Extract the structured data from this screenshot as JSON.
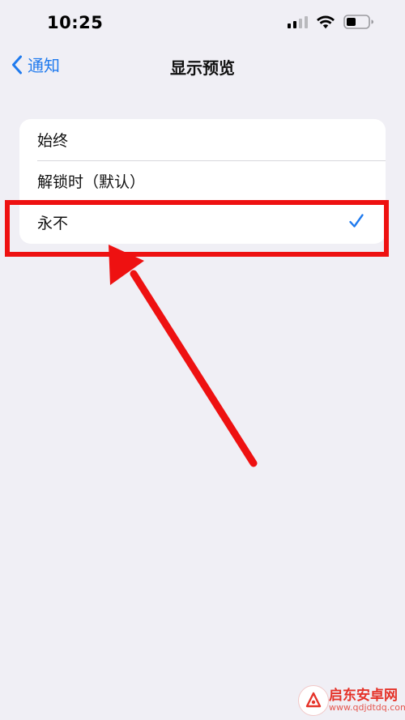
{
  "status_bar": {
    "time": "10:25",
    "icons": [
      "cellular-signal-icon",
      "wifi-icon",
      "battery-icon"
    ]
  },
  "nav": {
    "back_label": "通知",
    "title": "显示预览"
  },
  "options": [
    {
      "label": "始终",
      "selected": false
    },
    {
      "label": "解锁时（默认）",
      "selected": false
    },
    {
      "label": "永不",
      "selected": true
    }
  ],
  "colors": {
    "background": "#f0eff5",
    "accent": "#1f7aee",
    "annotation": "#ee1111"
  },
  "watermark": {
    "title": "启东安卓网",
    "url": "www.qdjdtdq.com"
  }
}
